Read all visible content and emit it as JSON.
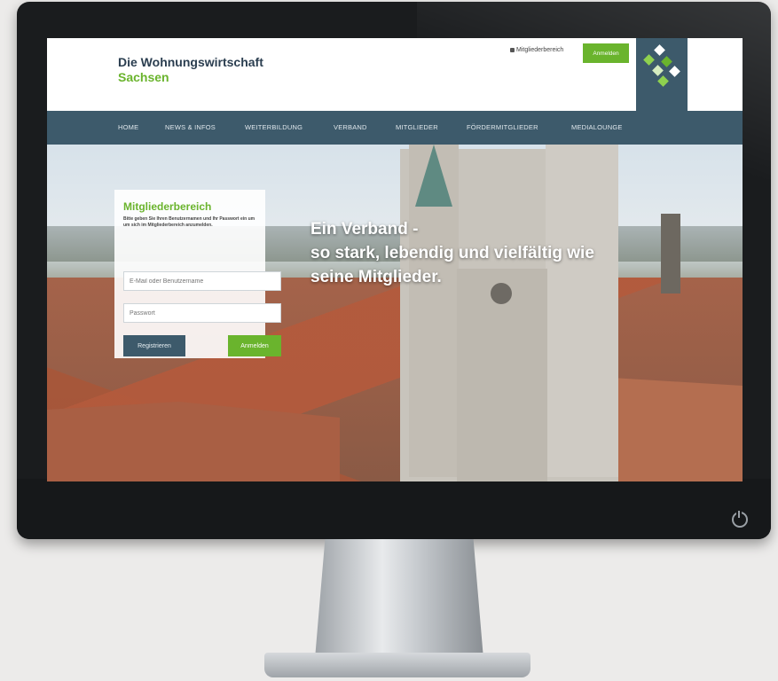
{
  "site": {
    "name_line1": "Die Wohnungswirtschaft",
    "name_line2": "Sachsen"
  },
  "header": {
    "members_link": "Mitgliederbereich",
    "login_button": "Anmelden"
  },
  "nav": {
    "items": [
      {
        "label": "HOME"
      },
      {
        "label": "NEWS & INFOS"
      },
      {
        "label": "WEITERBILDUNG"
      },
      {
        "label": "VERBAND"
      },
      {
        "label": "MITGLIEDER"
      },
      {
        "label": "FÖRDERMITGLIEDER"
      },
      {
        "label": "MEDIALOUNGE"
      }
    ]
  },
  "login_panel": {
    "title": "Mitgliederbereich",
    "description": "Bitte geben Sie Ihren Benutzernamen und Ihr Passwort ein um um sich im Mitgliederbereich anzumelden.",
    "username_placeholder": "E-Mail oder Benutzername",
    "password_placeholder": "Passwort",
    "register_button": "Registrieren",
    "login_button": "Anmelden"
  },
  "hero": {
    "line1": "Ein Verband -",
    "line2": "so stark, lebendig und vielfältig wie",
    "line3": "seine Mitglieder."
  },
  "colors": {
    "brand_green": "#6ab42d",
    "brand_blue": "#3d5a6b",
    "title_navy": "#2b3e50"
  },
  "icons": {
    "lock": "lock-icon",
    "power": "power-icon",
    "logo": "diamond-cluster-logo"
  }
}
